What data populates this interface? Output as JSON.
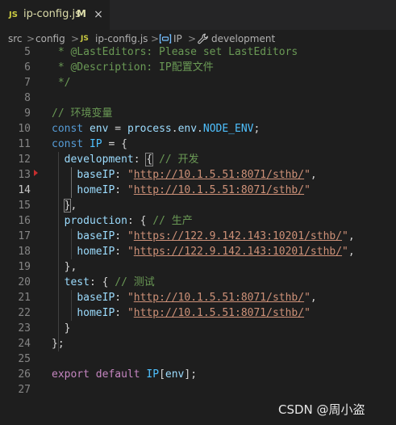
{
  "tab": {
    "file_icon_label": "JS",
    "filename": "ip-config.js",
    "modified_marker": "M",
    "close_glyph": "×"
  },
  "breadcrumb": {
    "segments": [
      "src",
      "config",
      "ip-config.js",
      "IP",
      "development"
    ],
    "file_icon_label": "JS",
    "separator": ">"
  },
  "editor": {
    "active_line": 14,
    "lines": [
      {
        "n": "5",
        "tokens": [
          {
            "c": "t-comment",
            "t": " * @LastEditors: Please set LastEditors"
          }
        ]
      },
      {
        "n": "6",
        "tokens": [
          {
            "c": "t-comment",
            "t": " * @Description: IP配置文件"
          }
        ]
      },
      {
        "n": "7",
        "tokens": [
          {
            "c": "t-comment",
            "t": " */"
          }
        ]
      },
      {
        "n": "8",
        "tokens": []
      },
      {
        "n": "9",
        "tokens": [
          {
            "c": "t-comment",
            "t": "// 环境变量"
          }
        ]
      },
      {
        "n": "10",
        "tokens": [
          {
            "c": "t-keyword",
            "t": "const "
          },
          {
            "c": "t-var",
            "t": "env"
          },
          {
            "c": "t-punct",
            "t": " = "
          },
          {
            "c": "t-var",
            "t": "process"
          },
          {
            "c": "t-punct",
            "t": "."
          },
          {
            "c": "t-var",
            "t": "env"
          },
          {
            "c": "t-punct",
            "t": "."
          },
          {
            "c": "t-const",
            "t": "NODE_ENV"
          },
          {
            "c": "t-punct",
            "t": ";"
          }
        ]
      },
      {
        "n": "11",
        "tokens": [
          {
            "c": "t-keyword",
            "t": "const "
          },
          {
            "c": "t-const",
            "t": "IP"
          },
          {
            "c": "t-punct",
            "t": " = {"
          }
        ]
      },
      {
        "n": "12",
        "tokens": [
          {
            "c": "t-punct",
            "t": "  "
          },
          {
            "c": "t-prop",
            "t": "development"
          },
          {
            "c": "t-punct",
            "t": ": "
          },
          {
            "c": "t-bracket-match",
            "t": "{"
          },
          {
            "c": "t-punct",
            "t": " "
          },
          {
            "c": "t-comment",
            "t": "// 开发"
          }
        ]
      },
      {
        "n": "13",
        "tokens": [
          {
            "c": "t-punct",
            "t": "    "
          },
          {
            "c": "t-prop",
            "t": "baseIP"
          },
          {
            "c": "t-punct",
            "t": ": "
          },
          {
            "c": "t-string",
            "t": "\""
          },
          {
            "c": "t-url",
            "t": "http://10.1.5.51:8071/sthb/"
          },
          {
            "c": "t-string",
            "t": "\""
          },
          {
            "c": "t-punct",
            "t": ","
          }
        ]
      },
      {
        "n": "14",
        "tokens": [
          {
            "c": "t-punct",
            "t": "    "
          },
          {
            "c": "t-prop",
            "t": "homeIP"
          },
          {
            "c": "t-punct",
            "t": ": "
          },
          {
            "c": "t-string",
            "t": "\""
          },
          {
            "c": "t-url",
            "t": "http://10.1.5.51:8071/sthb/"
          },
          {
            "c": "t-string",
            "t": "\""
          }
        ]
      },
      {
        "n": "15",
        "tokens": [
          {
            "c": "t-punct",
            "t": "  "
          },
          {
            "c": "t-bracket-match",
            "t": "}"
          },
          {
            "c": "t-punct",
            "t": ","
          }
        ]
      },
      {
        "n": "16",
        "tokens": [
          {
            "c": "t-punct",
            "t": "  "
          },
          {
            "c": "t-prop",
            "t": "production"
          },
          {
            "c": "t-punct",
            "t": ": { "
          },
          {
            "c": "t-comment",
            "t": "// 生产"
          }
        ]
      },
      {
        "n": "17",
        "tokens": [
          {
            "c": "t-punct",
            "t": "    "
          },
          {
            "c": "t-prop",
            "t": "baseIP"
          },
          {
            "c": "t-punct",
            "t": ": "
          },
          {
            "c": "t-string",
            "t": "\""
          },
          {
            "c": "t-url",
            "t": "https://122.9.142.143:10201/sthb/"
          },
          {
            "c": "t-string",
            "t": "\""
          },
          {
            "c": "t-punct",
            "t": ","
          }
        ]
      },
      {
        "n": "18",
        "tokens": [
          {
            "c": "t-punct",
            "t": "    "
          },
          {
            "c": "t-prop",
            "t": "homeIP"
          },
          {
            "c": "t-punct",
            "t": ": "
          },
          {
            "c": "t-string",
            "t": "\""
          },
          {
            "c": "t-url",
            "t": "https://122.9.142.143:10201/sthb/"
          },
          {
            "c": "t-string",
            "t": "\""
          },
          {
            "c": "t-punct",
            "t": ","
          }
        ]
      },
      {
        "n": "19",
        "tokens": [
          {
            "c": "t-punct",
            "t": "  },"
          }
        ]
      },
      {
        "n": "20",
        "tokens": [
          {
            "c": "t-punct",
            "t": "  "
          },
          {
            "c": "t-prop",
            "t": "test"
          },
          {
            "c": "t-punct",
            "t": ": { "
          },
          {
            "c": "t-comment",
            "t": "// 测试"
          }
        ]
      },
      {
        "n": "21",
        "tokens": [
          {
            "c": "t-punct",
            "t": "    "
          },
          {
            "c": "t-prop",
            "t": "baseIP"
          },
          {
            "c": "t-punct",
            "t": ": "
          },
          {
            "c": "t-string",
            "t": "\""
          },
          {
            "c": "t-url",
            "t": "http://10.1.5.51:8071/sthb/"
          },
          {
            "c": "t-string",
            "t": "\""
          },
          {
            "c": "t-punct",
            "t": ","
          }
        ]
      },
      {
        "n": "22",
        "tokens": [
          {
            "c": "t-punct",
            "t": "    "
          },
          {
            "c": "t-prop",
            "t": "homeIP"
          },
          {
            "c": "t-punct",
            "t": ": "
          },
          {
            "c": "t-string",
            "t": "\""
          },
          {
            "c": "t-url",
            "t": "http://10.1.5.51:8071/sthb/"
          },
          {
            "c": "t-string",
            "t": "\""
          }
        ]
      },
      {
        "n": "23",
        "tokens": [
          {
            "c": "t-punct",
            "t": "  }"
          }
        ]
      },
      {
        "n": "24",
        "tokens": [
          {
            "c": "t-punct",
            "t": "};"
          }
        ]
      },
      {
        "n": "25",
        "tokens": []
      },
      {
        "n": "26",
        "tokens": [
          {
            "c": "t-export",
            "t": "export default "
          },
          {
            "c": "t-const",
            "t": "IP"
          },
          {
            "c": "t-punct",
            "t": "["
          },
          {
            "c": "t-var",
            "t": "env"
          },
          {
            "c": "t-punct",
            "t": "];"
          }
        ]
      },
      {
        "n": "27",
        "tokens": []
      }
    ]
  },
  "watermark": "CSDN @周小盗",
  "colors": {
    "editor_bg": "#1e1e1e",
    "tab_bg": "#252526",
    "comment": "#6a9955",
    "keyword": "#569cd6",
    "string": "#ce9178",
    "variable": "#9cdcfe",
    "constant": "#4fc1ff",
    "export": "#c586c0"
  }
}
